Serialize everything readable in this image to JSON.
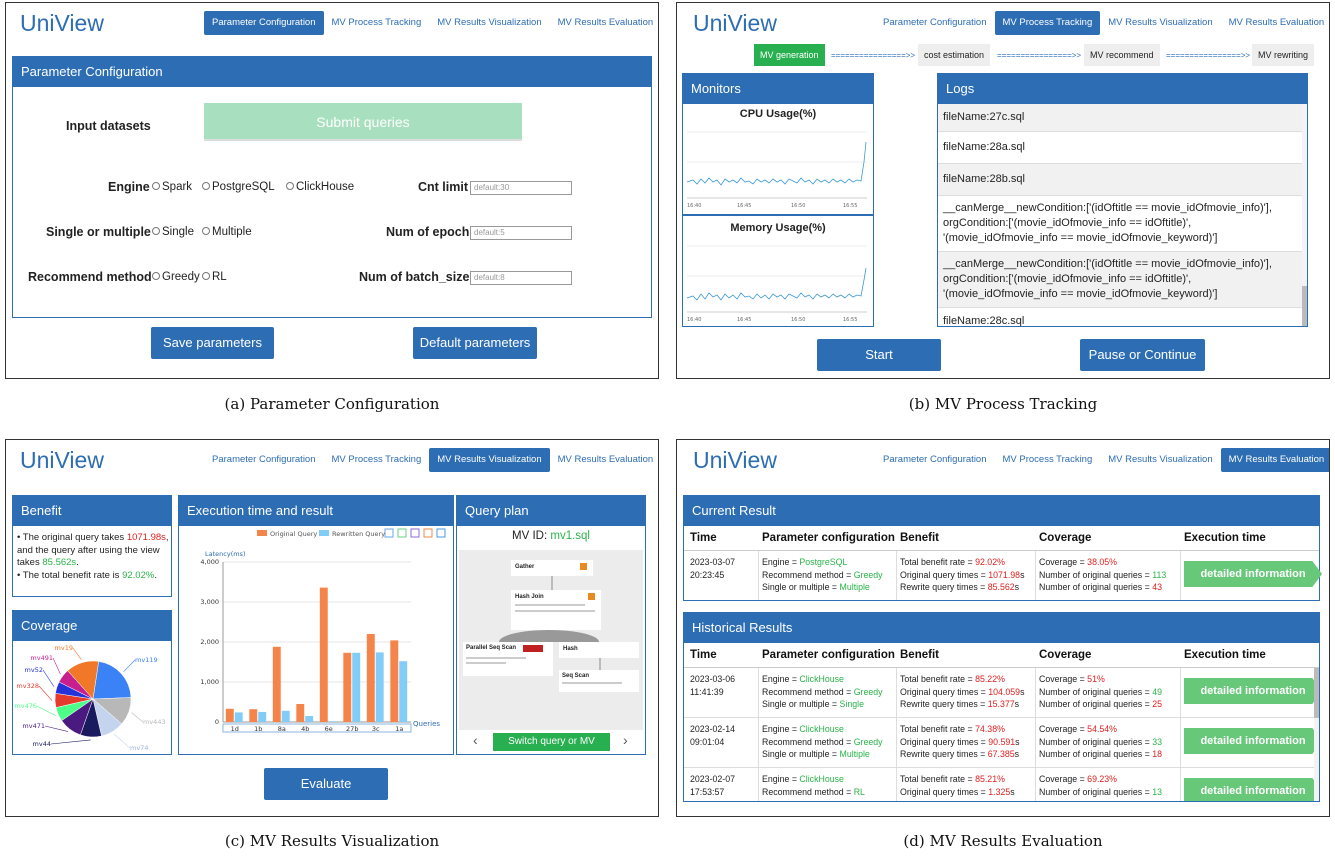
{
  "logo": "UniView",
  "nav": [
    "Parameter Configuration",
    "MV Process Tracking",
    "MV Results Visualization",
    "MV Results Evaluation"
  ],
  "captions": [
    "(a)  Parameter Configuration",
    "(b)  MV Process Tracking",
    "(c)  MV Results Visualization",
    "(d)  MV Results Evaluation"
  ],
  "a": {
    "box_title": "Parameter Configuration",
    "input_datasets": "Input datasets",
    "submit": "Submit queries",
    "engine": "Engine",
    "engine_opts": [
      "Spark",
      "PostgreSQL",
      "ClickHouse"
    ],
    "single_multiple": "Single or multiple",
    "sm_opts": [
      "Single",
      "Multiple"
    ],
    "recommend": "Recommend method",
    "rec_opts": [
      "Greedy",
      "RL"
    ],
    "cnt_limit": "Cnt limit",
    "cnt_ph": "default:30",
    "epoch": "Num of epoch",
    "epoch_ph": "default:5",
    "batch": "Num of batch_size",
    "batch_ph": "default:8",
    "save": "Save parameters",
    "default": "Default parameters"
  },
  "b": {
    "steps": [
      "MV generation",
      "cost estimation",
      "MV recommend",
      "MV rewriting"
    ],
    "arrow": "================>>",
    "monitors": "Monitors",
    "cpu": "CPU Usage(%)",
    "mem": "Memory Usage(%)",
    "times": [
      "16:40",
      "16:45",
      "16:50",
      "16:55"
    ],
    "logs_title": "Logs",
    "logs": [
      "fileName:27c.sql",
      "fileName:28a.sql",
      "fileName:28b.sql",
      "__canMerge__newCondition:['(idOftitle == movie_idOfmovie_info)'], orgCondition:['(movie_idOfmovie_info == idOftitle)', '(movie_idOfmovie_info == movie_idOfmovie_keyword)']",
      "__canMerge__newCondition:['(idOftitle == movie_idOfmovie_info)'], orgCondition:['(movie_idOfmovie_info == idOftitle)', '(movie_idOfmovie_info == movie_idOfmovie_keyword)']",
      "fileName:28c.sql"
    ],
    "start": "Start",
    "pause": "Pause or Continue"
  },
  "c": {
    "benefit_title": "Benefit",
    "benefit_1a": "The original query takes ",
    "benefit_1b": "1071.98s",
    "benefit_1c": ", and the query after using the view takes ",
    "benefit_1d": "85.562s",
    "benefit_1e": ".",
    "benefit_2a": "The total benefit rate is ",
    "benefit_2b": "92.02%",
    "benefit_2c": ".",
    "coverage_title": "Coverage",
    "exec_title": "Execution time and result",
    "plan_title": "Query plan",
    "mv_id_label": "MV ID: ",
    "mv_id": "mv1.sql",
    "switch": "Switch query or MV",
    "evaluate": "Evaluate",
    "plan_nodes": [
      "Gather",
      "Hash Join",
      "Parallel Seq Scan",
      "Hash",
      "Seq Scan"
    ]
  },
  "chart_data": [
    {
      "type": "bar",
      "ylabel": "Latency(ms)",
      "xlabel": "Queries",
      "categories": [
        "1d",
        "1b",
        "8a",
        "4b",
        "6e",
        "27b",
        "3c",
        "1a"
      ],
      "series": [
        {
          "name": "Original Query",
          "values": [
            330,
            320,
            1880,
            450,
            3360,
            1730,
            2200,
            2040
          ],
          "color": "#f5844a"
        },
        {
          "name": "Rewritten Query",
          "values": [
            240,
            250,
            280,
            150,
            20,
            1730,
            1740,
            1520
          ],
          "color": "#82cdf7"
        }
      ],
      "ylim": [
        0,
        4000
      ],
      "yticks": [
        0,
        1000,
        2000,
        3000,
        4000
      ],
      "ytick_labels": [
        "0",
        "1,000",
        "2,000",
        "3,000",
        "4,000"
      ]
    },
    {
      "type": "pie",
      "labels": [
        "mv119",
        "mv443",
        "mv74",
        "mv44",
        "mv471",
        "mv476",
        "mv328",
        "mv52",
        "mv491",
        "mv19"
      ],
      "values": [
        22,
        12,
        10,
        9,
        10,
        6,
        6,
        5,
        6,
        14
      ],
      "colors": [
        "#3b82f6",
        "#b8b8b8",
        "#c4d4ee",
        "#1a1a5e",
        "#4b1a80",
        "#4dff88",
        "#e43b2d",
        "#2433d8",
        "#c81f8e",
        "#f07828"
      ]
    }
  ],
  "d": {
    "current_title": "Current Result",
    "historical_title": "Historical Results",
    "headers": [
      "Time",
      "Parameter configuration",
      "Benefit",
      "Coverage",
      "Execution time"
    ],
    "detail": "detailed information",
    "current": {
      "date": "2023-03-07",
      "time": "20:23:45",
      "engine": "PostgreSQL",
      "method": "Greedy",
      "sm": "Multiple",
      "rate": "92.02%",
      "orig": "1071.98",
      "rew": "85.562",
      "cov": "38.05%",
      "nq": "113",
      "nr": "43"
    },
    "history": [
      {
        "date": "2023-03-06",
        "time": "11:41:39",
        "engine": "ClickHouse",
        "method": "Greedy",
        "sm": "Single",
        "rate": "85.22%",
        "orig": "104.059",
        "rew": "15.377",
        "cov": "51%",
        "nq": "49",
        "nr": "25"
      },
      {
        "date": "2023-02-14",
        "time": "09:01:04",
        "engine": "ClickHouse",
        "method": "Greedy",
        "sm": "Multiple",
        "rate": "74.38%",
        "orig": "90.591",
        "rew": "67.385",
        "cov": "54.54%",
        "nq": "33",
        "nr": "18"
      },
      {
        "date": "2023-02-07",
        "time": "17:53:57",
        "engine": "ClickHouse",
        "method": "RL",
        "sm": "",
        "rate": "85.21%",
        "orig": "1.325",
        "rew": "",
        "cov": "69.23%",
        "nq": "13",
        "nr": ""
      }
    ],
    "k_engine": "Engine = ",
    "k_method": "Recommend method = ",
    "k_sm": "Single or multiple = ",
    "k_rate": "Total benefit rate = ",
    "k_orig": "Original query times = ",
    "k_rew": "Rewrite query times = ",
    "k_cov": "Coverage = ",
    "k_nq": "Number of original queries = ",
    "k_nr": "Number of original queries = ",
    "s": "s"
  }
}
